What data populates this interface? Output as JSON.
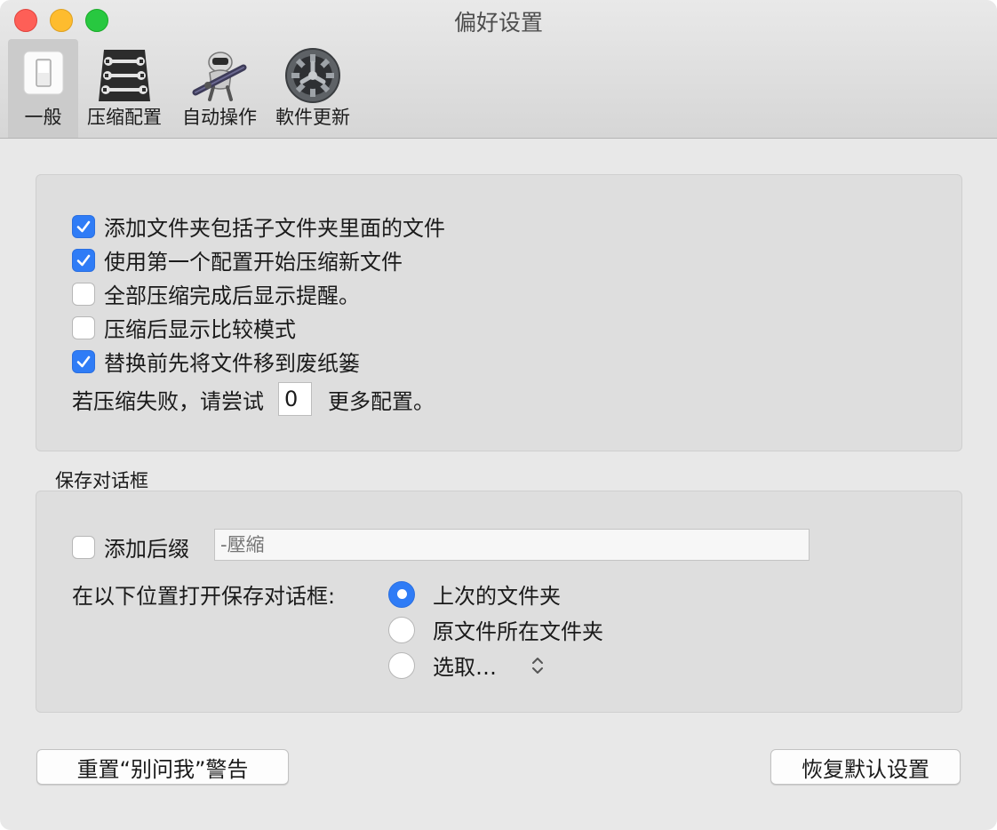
{
  "window": {
    "title": "偏好设置"
  },
  "toolbar": {
    "items": [
      {
        "label": "一般",
        "icon": "switch-icon",
        "selected": true
      },
      {
        "label": "压缩配置",
        "icon": "wrench-list-icon",
        "selected": false
      },
      {
        "label": "自动操作",
        "icon": "automator-robot-icon",
        "selected": false
      },
      {
        "label": "軟件更新",
        "icon": "gear-icon",
        "selected": false
      }
    ]
  },
  "general": {
    "options": [
      {
        "label": "添加文件夹包括子文件夹里面的文件",
        "checked": true
      },
      {
        "label": "使用第一个配置开始压缩新文件",
        "checked": true
      },
      {
        "label": "全部压缩完成后显示提醒。",
        "checked": false
      },
      {
        "label": "压缩后显示比较模式",
        "checked": false
      },
      {
        "label": "替换前先将文件移到废纸篓",
        "checked": true
      }
    ],
    "retry": {
      "prefix": "若压缩失败，请尝试",
      "value": "0",
      "suffix": "更多配置。"
    }
  },
  "save_dialog": {
    "section_title": "保存对话框",
    "suffix": {
      "label": "添加后缀",
      "checked": false,
      "placeholder": "-壓縮"
    },
    "location": {
      "label": "在以下位置打开保存对话框:",
      "options": [
        {
          "label": "上次的文件夹",
          "selected": true
        },
        {
          "label": "原文件所在文件夹",
          "selected": false
        },
        {
          "label": "选取…",
          "selected": false
        }
      ]
    }
  },
  "buttons": {
    "reset_warnings": "重置“别问我”警告",
    "restore_defaults": "恢复默认设置"
  },
  "colors": {
    "accent": "#2f7cf6",
    "close": "#fe5f57",
    "minimize": "#febc2e",
    "maximize": "#28c840"
  }
}
